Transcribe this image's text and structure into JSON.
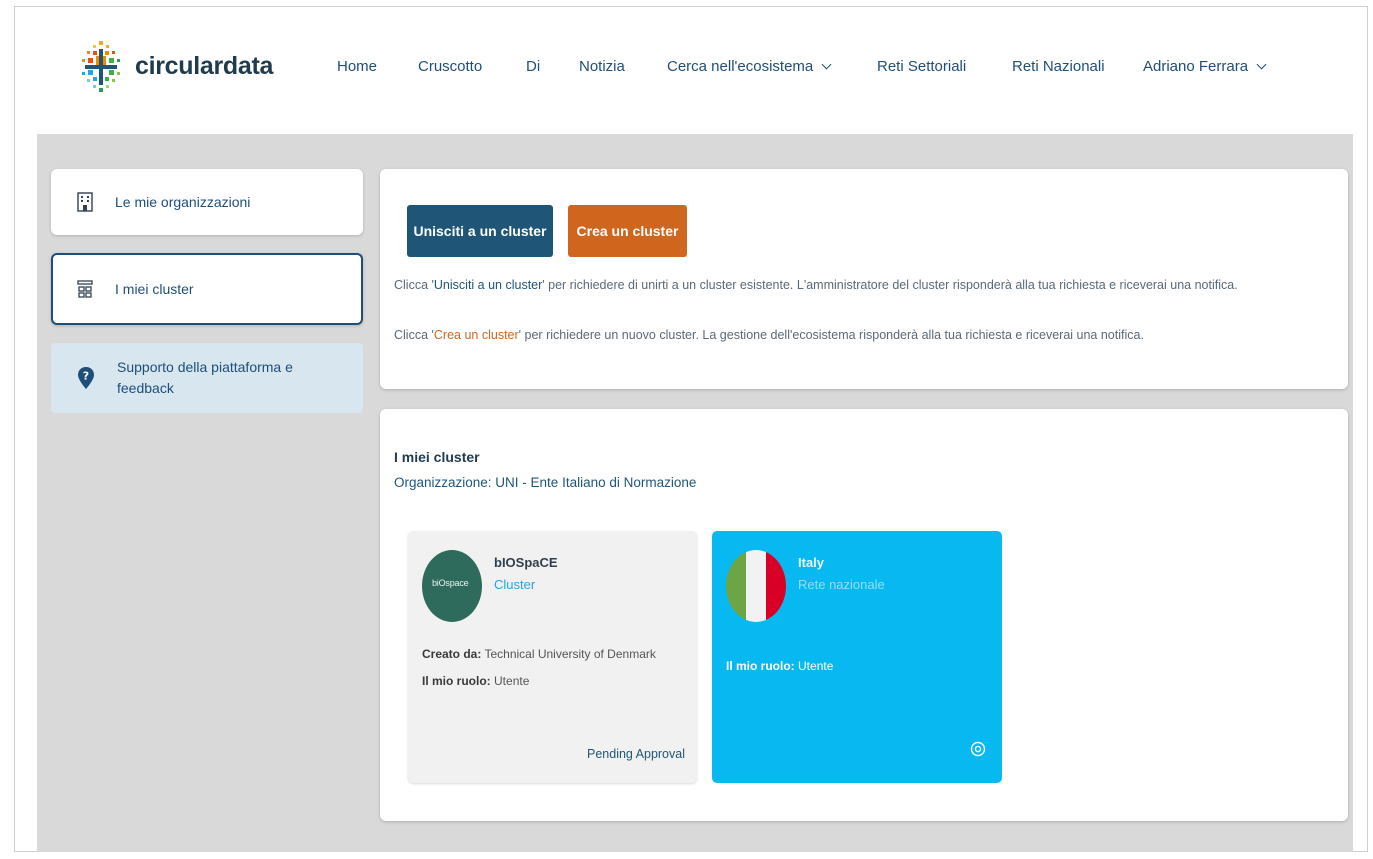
{
  "brand": {
    "name": "circulardata"
  },
  "nav": {
    "home": "Home",
    "cruscotto": "Cruscotto",
    "di": "Di",
    "notizia": "Notizia",
    "cerca": "Cerca nell'ecosistema",
    "reti_settoriali": "Reti Settoriali",
    "reti_nazionali": "Reti Nazionali",
    "user": "Adriano Ferrara"
  },
  "sidebar": {
    "items": [
      {
        "label": "Le mie organizzazioni",
        "icon": "building-icon"
      },
      {
        "label": "I miei cluster",
        "icon": "cluster-icon"
      },
      {
        "label": "Supporto della piattaforma e feedback",
        "icon": "help-pin-icon"
      }
    ]
  },
  "actions": {
    "join_label": "Unisciti a un cluster",
    "create_label": "Crea un cluster",
    "info_1_pre": "Clicca '",
    "info_1_hl": "Unisciti a un cluster",
    "info_1_post": "' per richiedere di unirti a un cluster esistente. L'amministratore del cluster risponderà alla tua richiesta e riceverai una notifica.",
    "info_2_pre": "Clicca '",
    "info_2_hl": "Crea un cluster",
    "info_2_post": "' per richiedere un nuovo cluster. La gestione dell'ecosistema risponderà alla tua richiesta e riceverai una notifica."
  },
  "clusters": {
    "title": "I miei cluster",
    "organization": "Organizzazione: UNI - Ente Italiano di Normazione",
    "cards": [
      {
        "name": "bIOSpaCE",
        "type": "Cluster",
        "avatar_text": "biOspace",
        "created_by_label": "Creato da:",
        "created_by": "Technical University of Denmark",
        "role_label": "Il mio ruolo:",
        "role": "Utente",
        "status": "Pending Approval"
      },
      {
        "name": "Italy",
        "type": "Rete nazionale",
        "role_label": "Il mio ruolo:",
        "role": "Utente",
        "icon": "eye-icon"
      }
    ]
  },
  "colors": {
    "primary": "#1f5677",
    "accent": "#d0661e",
    "card_blue": "#08b8f0",
    "background": "#d9d9d9"
  }
}
